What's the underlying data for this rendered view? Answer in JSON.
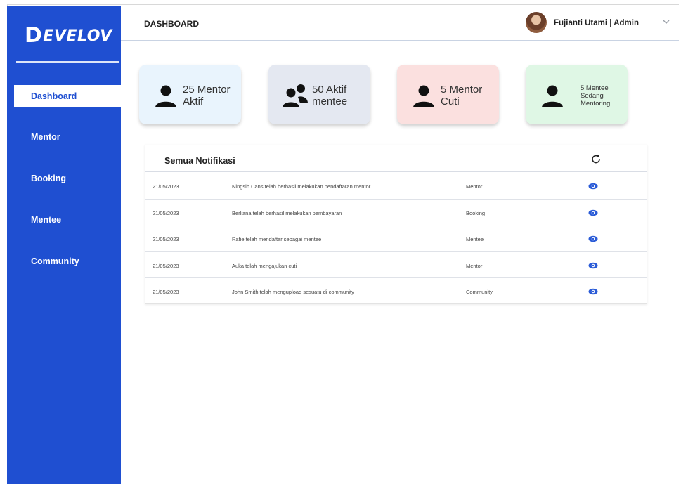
{
  "brand": {
    "logo_initial": "D",
    "logo_rest": "EVELOV"
  },
  "sidebar": {
    "items": [
      {
        "label": "Dashboard",
        "active": true
      },
      {
        "label": "Mentor",
        "active": false
      },
      {
        "label": "Booking",
        "active": false
      },
      {
        "label": "Mentee",
        "active": false
      },
      {
        "label": "Community",
        "active": false
      }
    ]
  },
  "header": {
    "title": "DASHBOARD",
    "user": "Fujianti Utami | Admin"
  },
  "stats": [
    {
      "line1": "25 Mentor",
      "line2": "Aktif",
      "line3": "",
      "icon": "user-icon",
      "bg": "#e9f4fd"
    },
    {
      "line1": "50 Aktif",
      "line2": "mentee",
      "line3": "",
      "icon": "users-icon",
      "bg": "#e4e8f1"
    },
    {
      "line1": "5 Mentor",
      "line2": "Cuti",
      "line3": "",
      "icon": "user-icon",
      "bg": "#fbe0df"
    },
    {
      "line1": "5 Mentee",
      "line2": "Sedang",
      "line3": "Mentoring",
      "icon": "user-icon",
      "bg": "#dff7e5"
    }
  ],
  "notifications": {
    "title": "Semua Notifikasi",
    "rows": [
      {
        "date": "21/05/2023",
        "message": "Ningsih Cans telah berhasil melakukan pendaftaran mentor",
        "category": "Mentor"
      },
      {
        "date": "21/05/2023",
        "message": "Berliana telah berhasil melakukan pembayaran",
        "category": "Booking"
      },
      {
        "date": "21/05/2023",
        "message": "Rafie telah mendaftar sebagai mentee",
        "category": "Mentee"
      },
      {
        "date": "21/05/2023",
        "message": "Auka telah mengajukan cuti",
        "category": "Mentor"
      },
      {
        "date": "21/05/2023",
        "message": "John Smith telah mengupload sesuatu di community",
        "category": "Community"
      }
    ]
  },
  "colors": {
    "primary": "#1f4fd1",
    "eye": "#2a5bd7"
  }
}
